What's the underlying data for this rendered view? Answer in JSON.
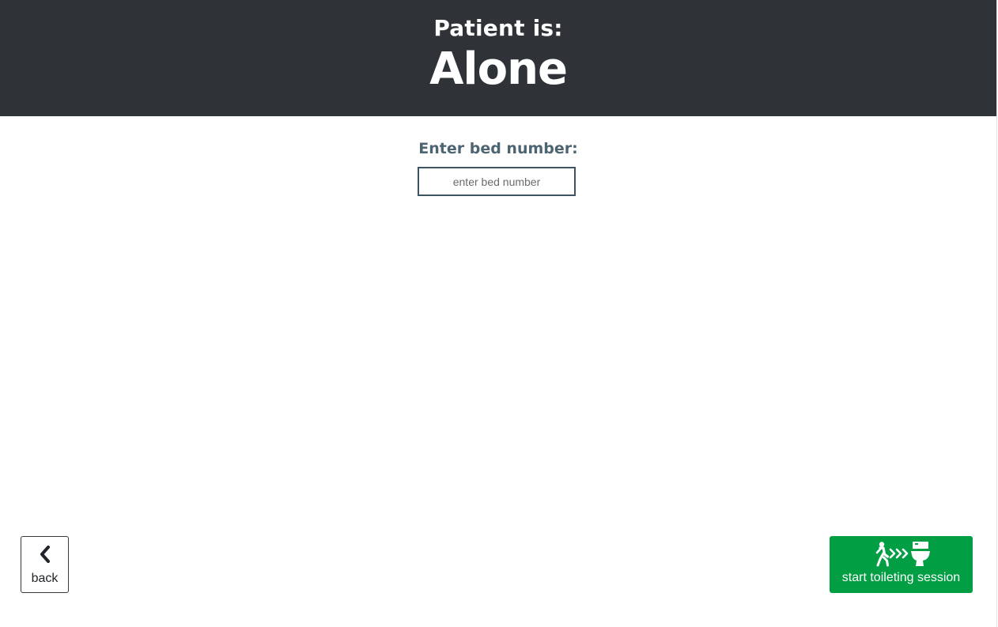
{
  "header": {
    "subtitle": "Patient is:",
    "status": "Alone"
  },
  "bed": {
    "label": "Enter bed number:",
    "placeholder": "enter bed number",
    "value": ""
  },
  "buttons": {
    "back": {
      "label": "back",
      "icon": "chevron-left-icon"
    },
    "start": {
      "label": "start toileting session",
      "icon": "walk-to-toilet-icon",
      "color": "#029e43"
    }
  },
  "colors": {
    "header_bg": "#2f3338",
    "label_color": "#4d6472"
  }
}
